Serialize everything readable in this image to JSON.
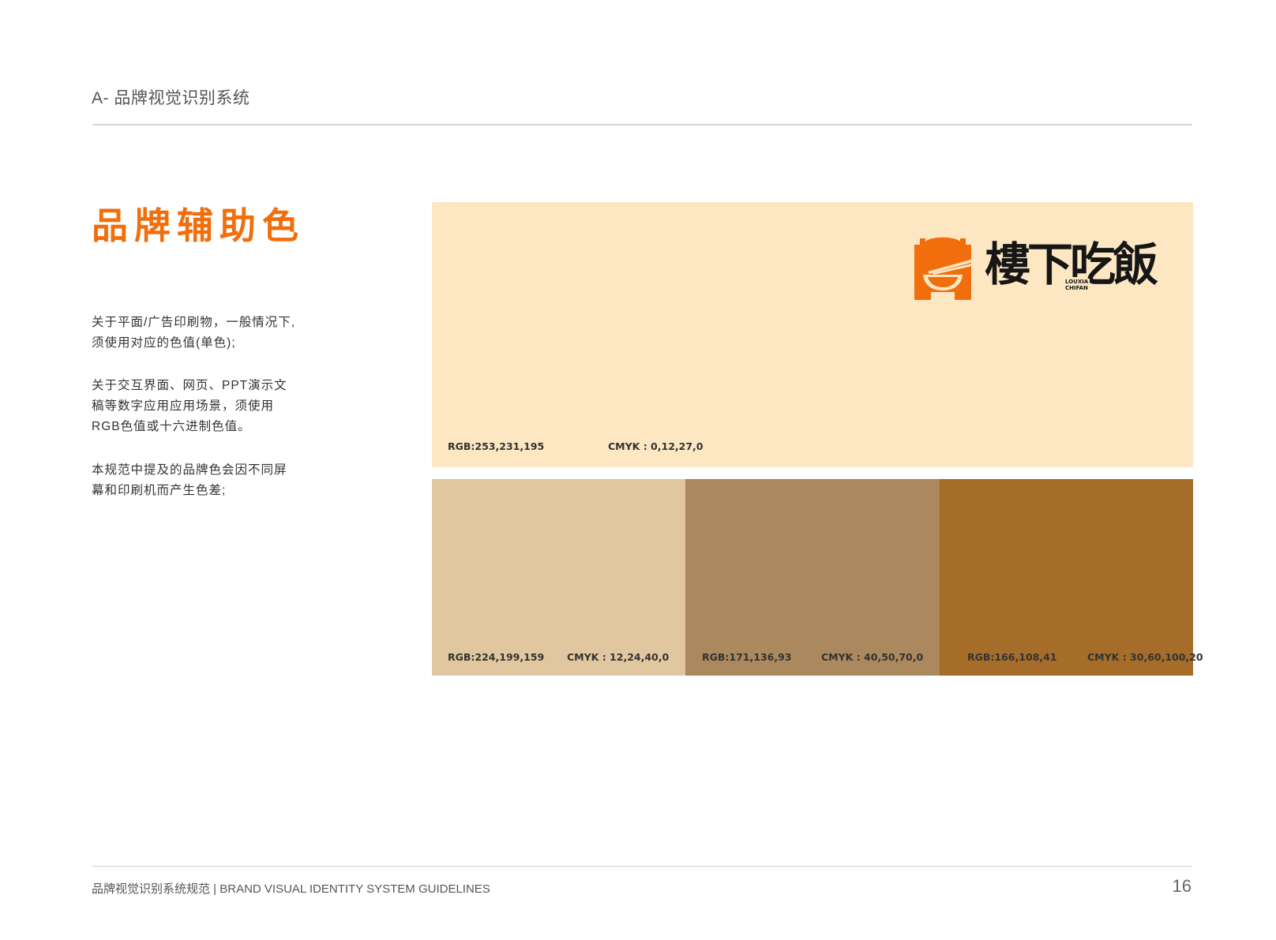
{
  "header": {
    "section_title": "A- 品牌视觉识别系统"
  },
  "main": {
    "heading": "品牌辅助色",
    "heading_color": "#f26e0c",
    "paragraphs": [
      [
        "关于平面/广告印刷物，一般情况下,",
        "须使用对应的色值(单色);"
      ],
      [
        "关于交互界面、网页、PPT演示文",
        "稿等数字应用应用场景，须使用",
        "RGB色值或十六进制色值。"
      ],
      [
        "本规范中提及的品牌色会因不同屏",
        "幕和印刷机而产生色差;"
      ]
    ]
  },
  "logo": {
    "wordmark": "樓下吃飯",
    "sub_line_1": "LOUXIA",
    "sub_line_2": "CHIFAN",
    "mark_color": "#f26e0c",
    "icon": "bowl-chopsticks-arch-icon"
  },
  "swatches": {
    "main": {
      "color": "#fde7c3",
      "rgb": "RGB:253,231,195",
      "cmyk": "CMYK : 0,12,27,0"
    },
    "secondary": [
      {
        "color": "#e0c79f",
        "rgb": "RGB:224,199,159",
        "cmyk": "CMYK : 12,24,40,0"
      },
      {
        "color": "#ab885d",
        "rgb": "RGB:171,136,93",
        "cmyk": "CMYK : 40,50,70,0"
      },
      {
        "color": "#a66c29",
        "rgb": "RGB:166,108,41",
        "cmyk": "CMYK : 30,60,100,20"
      }
    ]
  },
  "footer": {
    "text": "品牌视觉识别系统规范 | BRAND VISUAL IDENTITY SYSTEM GUIDELINES",
    "page_number": "16"
  }
}
